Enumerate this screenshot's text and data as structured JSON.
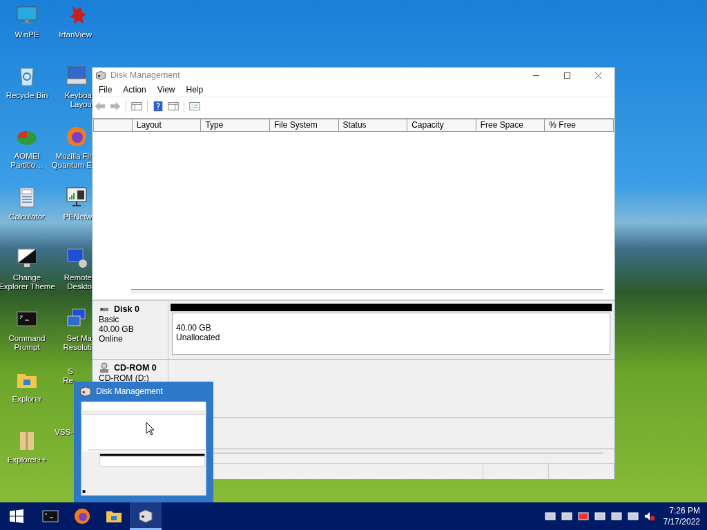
{
  "desktop_columns": [
    [
      {
        "kind": "monitor",
        "lines": [
          "WinPE"
        ]
      },
      {
        "kind": "recycle",
        "lines": [
          "Recycle Bin"
        ]
      },
      {
        "kind": "partition",
        "lines": [
          "AOMEI",
          "Partitio…"
        ]
      },
      {
        "kind": "calculator",
        "lines": [
          "Calculator"
        ]
      },
      {
        "kind": "theme",
        "lines": [
          "Change",
          "Explorer Theme"
        ]
      },
      {
        "kind": "console",
        "lines": [
          "Command",
          "Prompt"
        ]
      },
      {
        "kind": "folder",
        "lines": [
          "Explorer"
        ]
      },
      {
        "kind": "zip",
        "lines": [
          "Explorer++"
        ]
      }
    ],
    [
      {
        "kind": "mascot",
        "lines": [
          "IrfanView"
        ]
      },
      {
        "kind": "keyboard",
        "lines": [
          "Keyboa",
          "Layou"
        ]
      },
      {
        "kind": "browser",
        "lines": [
          "Mozilla Fir",
          "Quantum E"
        ]
      },
      {
        "kind": "network",
        "lines": [
          "PENetw"
        ]
      },
      {
        "kind": "remote",
        "lines": [
          "Remote",
          "Deskto"
        ]
      },
      {
        "kind": "screens",
        "lines": [
          "Set Ma",
          "Resoluti"
        ]
      },
      {
        "kind": "hidden",
        "lines": [
          "S",
          "Re"
        ]
      },
      {
        "kind": "hidden",
        "lines": [
          "VSS-"
        ]
      }
    ]
  ],
  "window": {
    "title": "Disk Management",
    "menu": [
      "File",
      "Action",
      "View",
      "Help"
    ],
    "toolbar": [
      {
        "kind": "back"
      },
      {
        "kind": "forward"
      },
      {
        "kind": "sep"
      },
      {
        "kind": "pane"
      },
      {
        "kind": "sep"
      },
      {
        "kind": "help"
      },
      {
        "kind": "pane2"
      },
      {
        "kind": "sep"
      },
      {
        "kind": "props"
      }
    ],
    "columns": [
      "Layout",
      "Type",
      "File System",
      "Status",
      "Capacity",
      "Free Space",
      "% Free"
    ],
    "disks": [
      {
        "kind": "disk",
        "name": "Disk 0",
        "lines": [
          "Basic",
          "40.00 GB",
          "Online"
        ],
        "partitions": [
          {
            "size": "40.00 GB",
            "label": "Unallocated"
          }
        ]
      },
      {
        "kind": "cdrom",
        "name": "CD-ROM 0",
        "lines": [
          "CD-ROM (D:)"
        ]
      }
    ]
  },
  "thumbnail": {
    "title": "Disk Management"
  },
  "taskbar": {
    "apps": [
      {
        "kind": "console",
        "selected": false
      },
      {
        "kind": "browser",
        "selected": false
      },
      {
        "kind": "folder",
        "selected": false
      },
      {
        "kind": "diskmgmt",
        "selected": true
      }
    ],
    "time": "7:26 PM",
    "date": "7/17/2022"
  }
}
